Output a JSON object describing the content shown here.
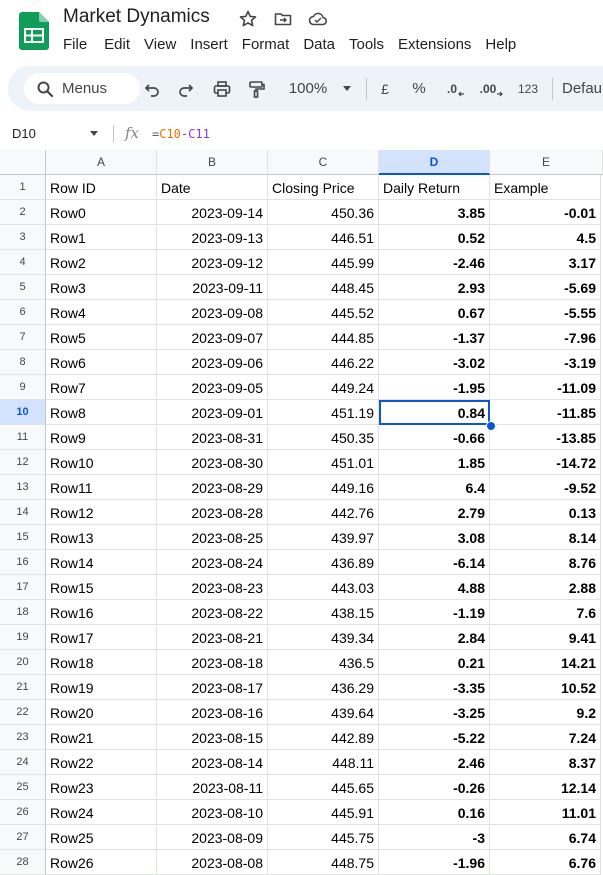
{
  "app": {
    "title": "Market Dynamics",
    "menus": [
      "File",
      "Edit",
      "View",
      "Insert",
      "Format",
      "Data",
      "Tools",
      "Extensions",
      "Help"
    ]
  },
  "toolbar": {
    "search_label": "Menus",
    "zoom": "100%",
    "currency": "£",
    "percent": "%",
    "decrease_decimal": ".0",
    "increase_decimal": ".00",
    "number_format": "123",
    "font": "Defau"
  },
  "formula_bar": {
    "name_box": "D10",
    "fx": "fx",
    "formula_eq": "=",
    "formula_ref1": "C10",
    "formula_op": "-",
    "formula_ref2": "C11"
  },
  "columns": [
    "A",
    "B",
    "C",
    "D",
    "E"
  ],
  "header": [
    "Row ID",
    "Date",
    "Closing Price",
    "Daily Return",
    "Example"
  ],
  "rows": [
    [
      "Row0",
      "2023-09-14",
      "450.36",
      "3.85",
      "-0.01"
    ],
    [
      "Row1",
      "2023-09-13",
      "446.51",
      "0.52",
      "4.5"
    ],
    [
      "Row2",
      "2023-09-12",
      "445.99",
      "-2.46",
      "3.17"
    ],
    [
      "Row3",
      "2023-09-11",
      "448.45",
      "2.93",
      "-5.69"
    ],
    [
      "Row4",
      "2023-09-08",
      "445.52",
      "0.67",
      "-5.55"
    ],
    [
      "Row5",
      "2023-09-07",
      "444.85",
      "-1.37",
      "-7.96"
    ],
    [
      "Row6",
      "2023-09-06",
      "446.22",
      "-3.02",
      "-3.19"
    ],
    [
      "Row7",
      "2023-09-05",
      "449.24",
      "-1.95",
      "-11.09"
    ],
    [
      "Row8",
      "2023-09-01",
      "451.19",
      "0.84",
      "-11.85"
    ],
    [
      "Row9",
      "2023-08-31",
      "450.35",
      "-0.66",
      "-13.85"
    ],
    [
      "Row10",
      "2023-08-30",
      "451.01",
      "1.85",
      "-14.72"
    ],
    [
      "Row11",
      "2023-08-29",
      "449.16",
      "6.4",
      "-9.52"
    ],
    [
      "Row12",
      "2023-08-28",
      "442.76",
      "2.79",
      "0.13"
    ],
    [
      "Row13",
      "2023-08-25",
      "439.97",
      "3.08",
      "8.14"
    ],
    [
      "Row14",
      "2023-08-24",
      "436.89",
      "-6.14",
      "8.76"
    ],
    [
      "Row15",
      "2023-08-23",
      "443.03",
      "4.88",
      "2.88"
    ],
    [
      "Row16",
      "2023-08-22",
      "438.15",
      "-1.19",
      "7.6"
    ],
    [
      "Row17",
      "2023-08-21",
      "439.34",
      "2.84",
      "9.41"
    ],
    [
      "Row18",
      "2023-08-18",
      "436.5",
      "0.21",
      "14.21"
    ],
    [
      "Row19",
      "2023-08-17",
      "436.29",
      "-3.35",
      "10.52"
    ],
    [
      "Row20",
      "2023-08-16",
      "439.64",
      "-3.25",
      "9.2"
    ],
    [
      "Row21",
      "2023-08-15",
      "442.89",
      "-5.22",
      "7.24"
    ],
    [
      "Row22",
      "2023-08-14",
      "448.11",
      "2.46",
      "8.37"
    ],
    [
      "Row23",
      "2023-08-11",
      "445.65",
      "-0.26",
      "12.14"
    ],
    [
      "Row24",
      "2023-08-10",
      "445.91",
      "0.16",
      "11.01"
    ],
    [
      "Row25",
      "2023-08-09",
      "445.75",
      "-3",
      "6.74"
    ],
    [
      "Row26",
      "2023-08-08",
      "448.75",
      "-1.96",
      "6.76"
    ]
  ],
  "selected_cell": {
    "col": "D",
    "row": 10
  },
  "colors": {
    "accent": "#0b57d0",
    "toolbar_bg": "#eef2f9",
    "logo_green": "#0f9d58"
  }
}
